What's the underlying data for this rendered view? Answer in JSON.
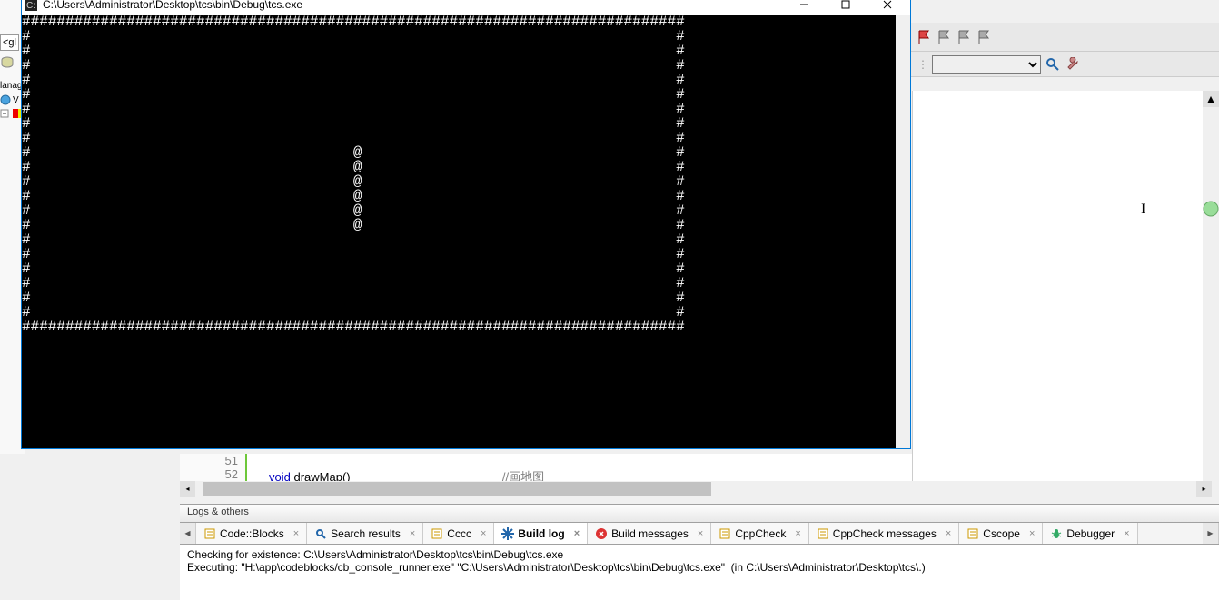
{
  "console": {
    "title": "C:\\Users\\Administrator\\Desktop\\tcs\\bin\\Debug\\tcs.exe",
    "lines": [
      "############################################################################",
      "#                                                                          #",
      "#                                                                          #",
      "#                                                                          #",
      "#                                                                          #",
      "#                                                                          #",
      "#                                                                          #",
      "#                                                                          #",
      "#                                                                          #",
      "#                                     @                                    #",
      "#                                     @                                    #",
      "#                                     @                                    #",
      "#                                     @                                    #",
      "#                                     @                                    #",
      "#                                     @                                    #",
      "#                                                                          #",
      "#                                                                          #",
      "#                                                                          #",
      "#                                                                          #",
      "#                                                                          #",
      "#                                                                          #",
      "############################################################################"
    ]
  },
  "ide_sidebar": {
    "tag": "<gl",
    "label": "lanag",
    "tree_item": "V"
  },
  "code": {
    "line_51": "51",
    "line_52": "52",
    "kw_void": "void",
    "fn": " drawMap()",
    "comment": "//画地图"
  },
  "logs": {
    "title": "Logs & others",
    "tabs": [
      {
        "label": "Code::Blocks",
        "icon": "notes"
      },
      {
        "label": "Search results",
        "icon": "search"
      },
      {
        "label": "Cccc",
        "icon": "notes"
      },
      {
        "label": "Build log",
        "icon": "gear",
        "active": true
      },
      {
        "label": "Build messages",
        "icon": "error"
      },
      {
        "label": "CppCheck",
        "icon": "notes"
      },
      {
        "label": "CppCheck messages",
        "icon": "notes"
      },
      {
        "label": "Cscope",
        "icon": "notes"
      },
      {
        "label": "Debugger",
        "icon": "bug"
      }
    ],
    "content_line1": "Checking for existence: C:\\Users\\Administrator\\Desktop\\tcs\\bin\\Debug\\tcs.exe",
    "content_line2": "Executing: \"H:\\app\\codeblocks/cb_console_runner.exe\" \"C:\\Users\\Administrator\\Desktop\\tcs\\bin\\Debug\\tcs.exe\"  (in C:\\Users\\Administrator\\Desktop\\tcs\\.)"
  },
  "cursor_char": "I"
}
